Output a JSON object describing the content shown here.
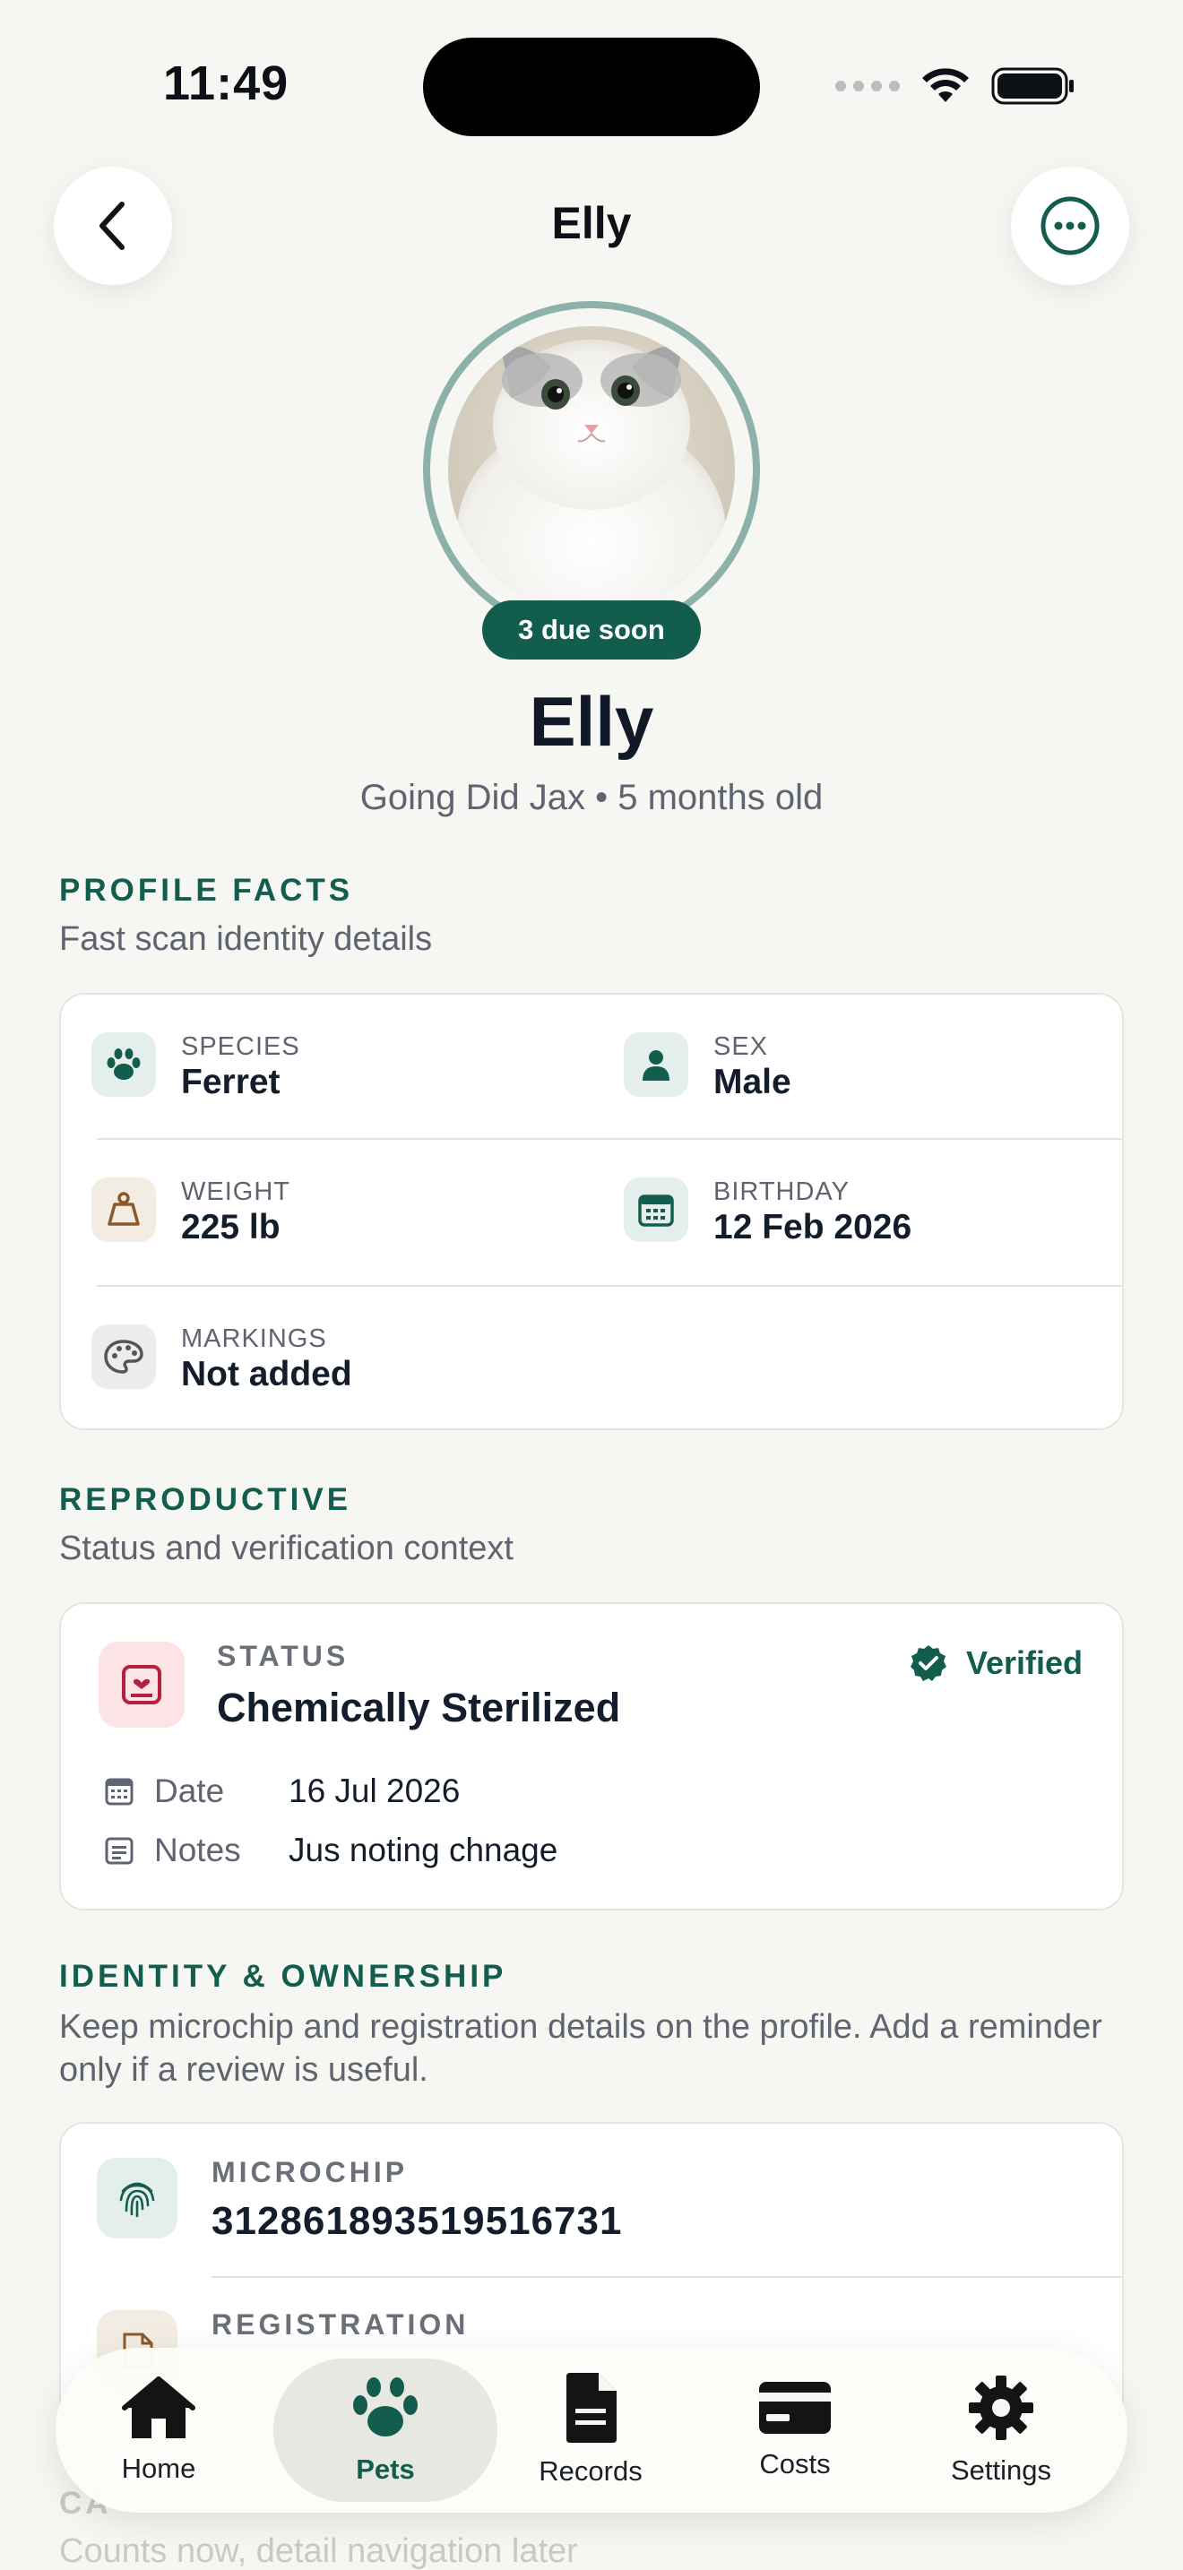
{
  "status": {
    "time": "11:49"
  },
  "nav": {
    "title": "Elly"
  },
  "pet": {
    "due_badge": "3 due soon",
    "name": "Elly",
    "breed": "Going Did Jax",
    "separator": "•",
    "age": "5 months old"
  },
  "profile_facts": {
    "title": "PROFILE FACTS",
    "description": "Fast scan identity details",
    "species": {
      "label": "SPECIES",
      "value": "Ferret"
    },
    "sex": {
      "label": "SEX",
      "value": "Male"
    },
    "weight": {
      "label": "WEIGHT",
      "value": "225 lb"
    },
    "birthday": {
      "label": "BIRTHDAY",
      "value": "12 Feb 2026"
    },
    "markings": {
      "label": "MARKINGS",
      "value": "Not added"
    }
  },
  "reproductive": {
    "title": "REPRODUCTIVE",
    "description": "Status and verification context",
    "status_label": "STATUS",
    "status_value": "Chemically Sterilized",
    "verified_label": "Verified",
    "date_label": "Date",
    "date_value": "16 Jul 2026",
    "notes_label": "Notes",
    "notes_value": "Jus noting chnage"
  },
  "identity": {
    "title": "IDENTITY & OWNERSHIP",
    "description": "Keep microchip and registration details on the profile. Add a reminder only if a review is useful.",
    "microchip_label": "MICROCHIP",
    "microchip_value": "312861893519516731",
    "registration_label": "REGISTRATION"
  },
  "next_section": {
    "title": "CA",
    "description": "Counts now, detail navigation later"
  },
  "tabbar": {
    "home": "Home",
    "pets": "Pets",
    "records": "Records",
    "costs": "Costs",
    "settings": "Settings"
  },
  "colors": {
    "accent": "#135d4f",
    "background": "#f6f6f2",
    "card": "#ffffff",
    "ring": "#8cb0aa",
    "reproductive_icon": "#b3213f",
    "weight_icon": "#8a5a2b"
  }
}
